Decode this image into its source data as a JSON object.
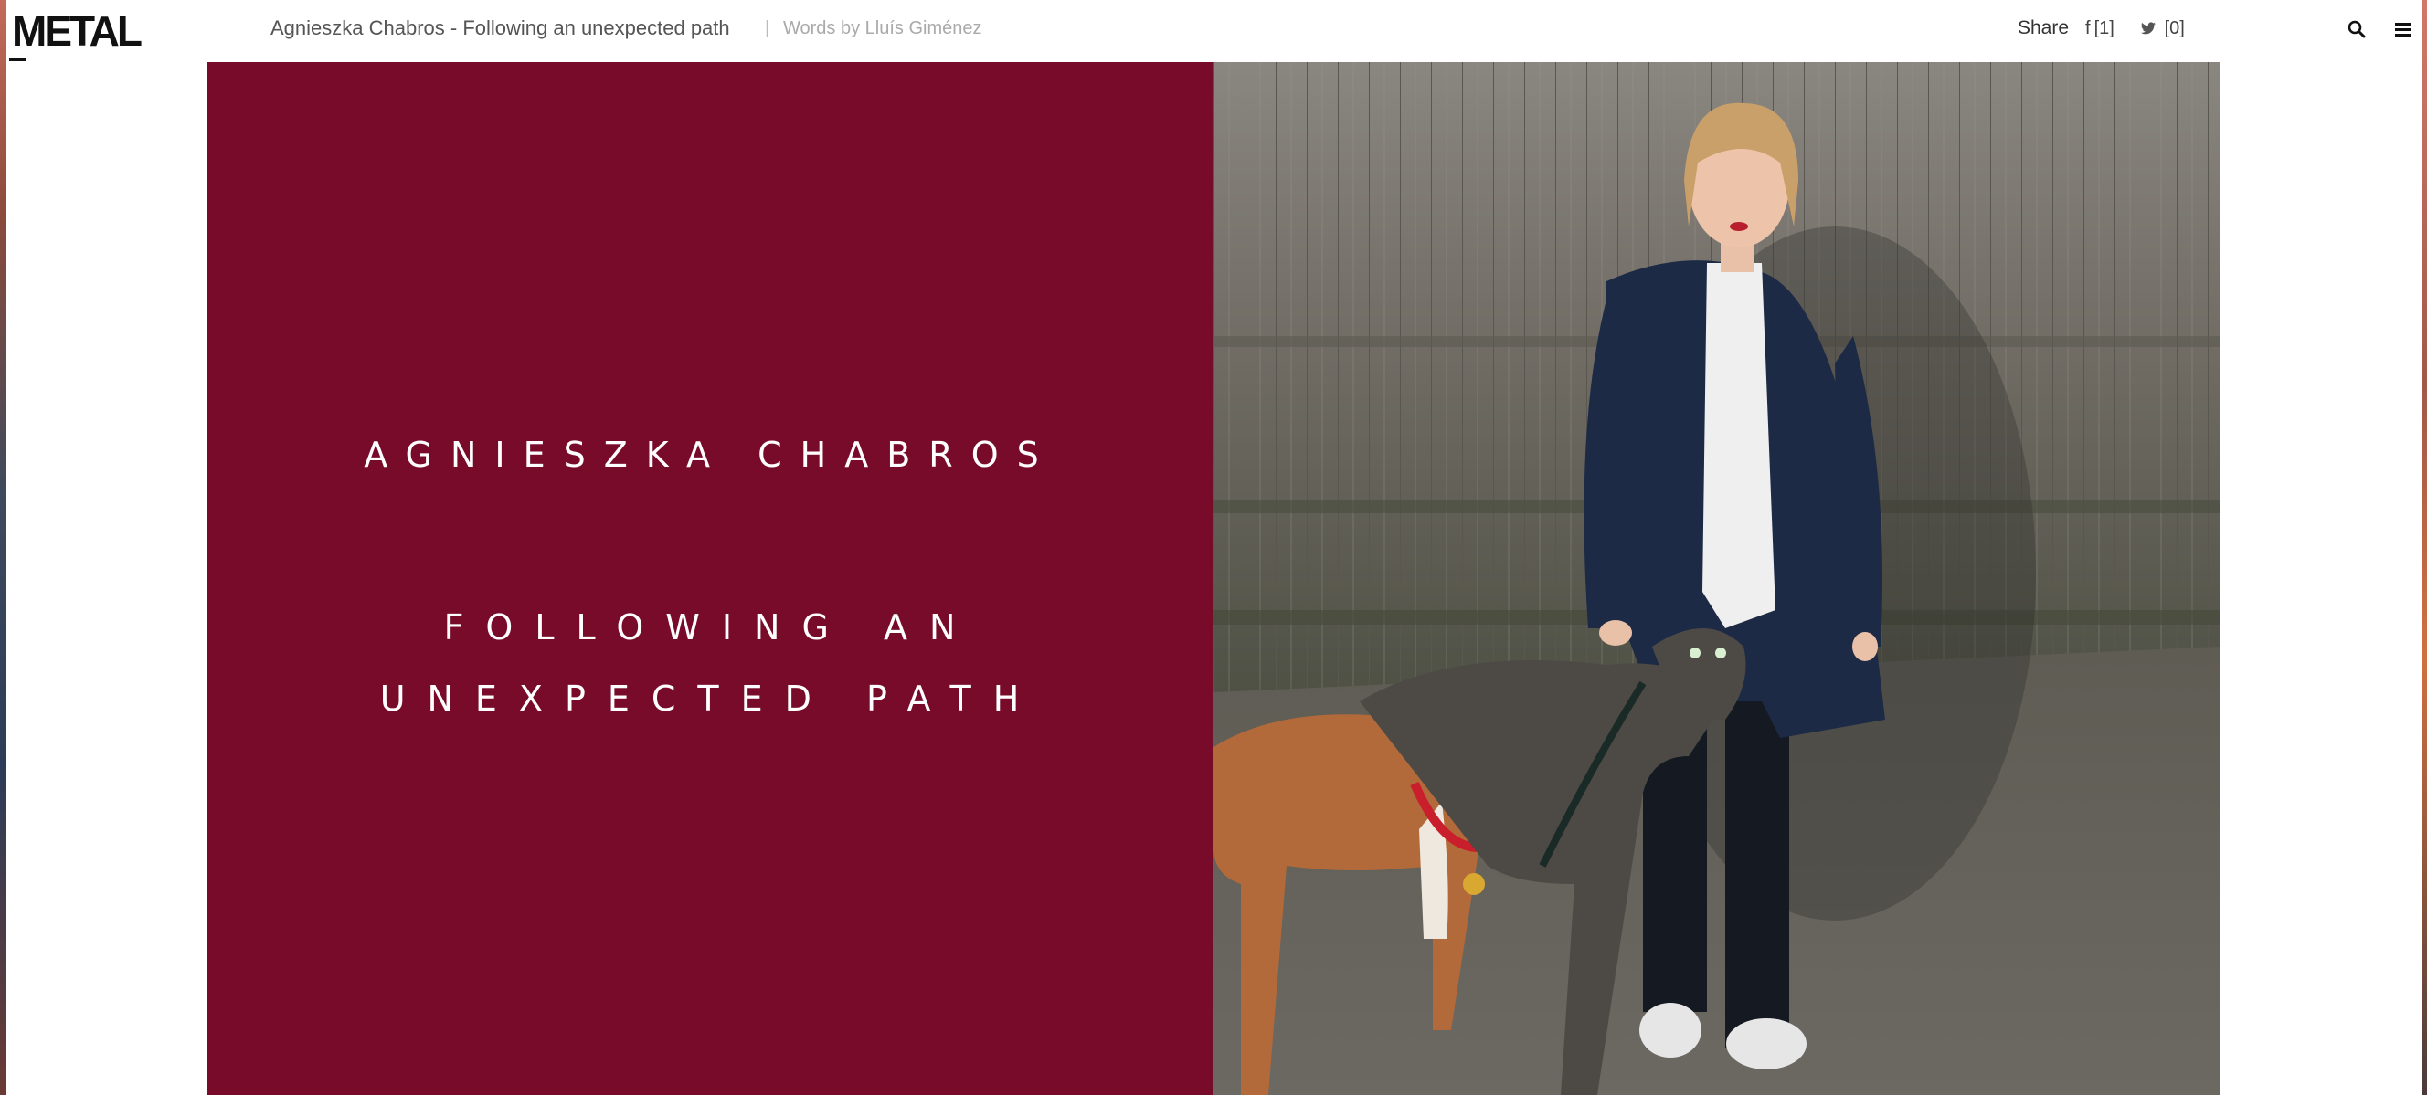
{
  "header": {
    "logo": "METAL",
    "article_title": "Agnieszka Chabros - Following an unexpected path",
    "separator": "|",
    "byline": "Words by Lluís Giménez",
    "share_label": "Share",
    "facebook_count": "[1]",
    "twitter_count": "[0]",
    "facebook_glyph": "f",
    "twitter_glyph": "🐦",
    "search_icon": "search-icon",
    "menu_icon": "menu-icon"
  },
  "hero": {
    "name": "AGNIESZKA CHABROS",
    "subtitle": "FOLLOWING AN UNEXPECTED PATH",
    "panel_color": "#770b29",
    "photo_description_icon": "portrait-photo"
  },
  "colors": {
    "accent": "#770b29",
    "text_dark": "#333333",
    "text_muted": "#aaaaaa"
  }
}
